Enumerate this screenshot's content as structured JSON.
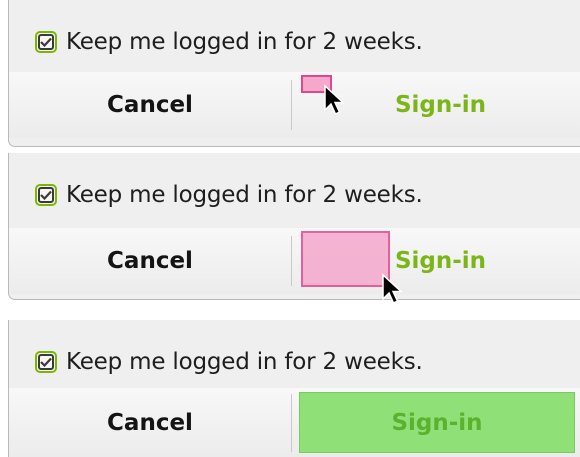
{
  "frames": [
    {
      "checkbox": {
        "icon": "checkbox-checked-icon",
        "checked": true,
        "label": "Keep me logged in for 2 weeks."
      },
      "buttons": {
        "cancel_label": "Cancel",
        "signin_label": "Sign-in"
      },
      "state": "dragging-small"
    },
    {
      "checkbox": {
        "icon": "checkbox-checked-icon",
        "checked": true,
        "label": "Keep me logged in for 2 weeks."
      },
      "buttons": {
        "cancel_label": "Cancel",
        "signin_label": "Sign-in"
      },
      "state": "dragging-large"
    },
    {
      "checkbox": {
        "icon": "checkbox-checked-icon",
        "checked": true,
        "label": "Keep me logged in for 2 weeks."
      },
      "buttons": {
        "cancel_label": "Cancel",
        "signin_label": "Sign-in"
      },
      "state": "sign-in-highlighted"
    }
  ],
  "colors": {
    "accent_green": "#7cb518",
    "highlight_green": "#8fe077",
    "selection_pink": "#f4a8cc",
    "selection_border": "#e0478d",
    "panel_bg": "#efefef"
  },
  "icons": {
    "cursor": "arrow-cursor-icon",
    "checkbox": "checkbox-checked-icon"
  }
}
